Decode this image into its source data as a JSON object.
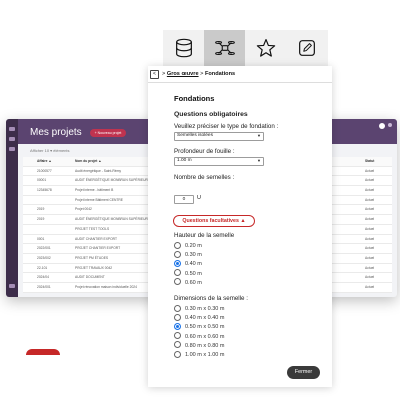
{
  "background_app": {
    "title": "Mes projets",
    "new_project_label": "+ Nouveau projet",
    "toolbar_text": "Afficher 10 ▾ éléments",
    "table": {
      "headers": [
        "Affaire ▲",
        "Nom du projet ▲",
        "Statut"
      ],
      "rows": [
        {
          "id": "21000577",
          "name": "Audit énergétique - Saint-Rémy",
          "status": "Actuel"
        },
        {
          "id": "00001",
          "name": "AUDIT ÉNERGÉTIQUE MONBRUN SUPÉRIEUR",
          "status": "Actuel"
        },
        {
          "id": "12345678",
          "name": "Projet interne - bâtiment B",
          "status": "Actuel"
        },
        {
          "id": "",
          "name": "Projet interne Bâtiment CENTRE",
          "status": "Actuel"
        },
        {
          "id": "2019",
          "name": "Projet 0042",
          "status": "Actuel"
        },
        {
          "id": "2019",
          "name": "AUDIT ÉNERGÉTIQUE MONBRUN SUPÉRIEUR",
          "status": "Actuel"
        },
        {
          "id": "",
          "name": "PROJET TEST TOOLS",
          "status": "Actuel"
        },
        {
          "id": "0001",
          "name": "AUDIT CHANTIER EXPORT",
          "status": "Actuel"
        },
        {
          "id": "2022/001",
          "name": "PROJET CHANTIER EXPORT",
          "status": "Actuel"
        },
        {
          "id": "2023/002",
          "name": "PROJET PM ÉTUDES",
          "status": "Actuel"
        },
        {
          "id": "22-101",
          "name": "PROJET TRAVAUX 0042",
          "status": "Actuel"
        },
        {
          "id": "2024/04",
          "name": "AUDIT DOCUMENT",
          "status": "Actuel"
        },
        {
          "id": "2024/001",
          "name": "Projet rénovation maison individuelle 2024",
          "status": "Actuel"
        }
      ]
    }
  },
  "tabs": [
    {
      "name": "database-icon",
      "active": false
    },
    {
      "name": "drone-icon",
      "active": true
    },
    {
      "name": "star-icon",
      "active": false
    },
    {
      "name": "pencil-icon",
      "active": false
    }
  ],
  "breadcrumb": {
    "back_symbol": "<",
    "sep1": ">",
    "parent": "Gros œuvre",
    "sep2": ">",
    "current": "Fondations"
  },
  "form": {
    "title": "Fondations",
    "required_title": "Questions obligatoires",
    "foundation_type": {
      "label": "Veuillez préciser le type de fondation :",
      "value": "Semelles isolées"
    },
    "depth": {
      "label": "Profondeur de fouille :",
      "value": "1.00 m"
    },
    "count": {
      "label": "Nombre de semelles :",
      "value": "0",
      "unit": "U"
    },
    "optional_button": "Questions facultatives ▲",
    "height": {
      "label": "Hauteur de la semelle",
      "options": [
        "0.20 m",
        "0.30 m",
        "0.40 m",
        "0.50 m",
        "0.60 m"
      ],
      "selected_index": 2
    },
    "dimensions": {
      "label": "Dimensions de la semelle :",
      "options": [
        "0.30 m x 0.30 m",
        "0.40 m x 0.40 m",
        "0.50 m x 0.50 m",
        "0.60 m x 0.60 m",
        "0.80 m x 0.80 m",
        "1.00 m x 1.00 m"
      ],
      "selected_index": 2
    }
  },
  "close_button": "Fermer",
  "colors": {
    "accent_red": "#c62828",
    "radio_selected": "#1a73e8",
    "app_header": "#5b4470",
    "app_sidebar": "#3d2d4a",
    "close_button_bg": "#3a3a3a"
  }
}
